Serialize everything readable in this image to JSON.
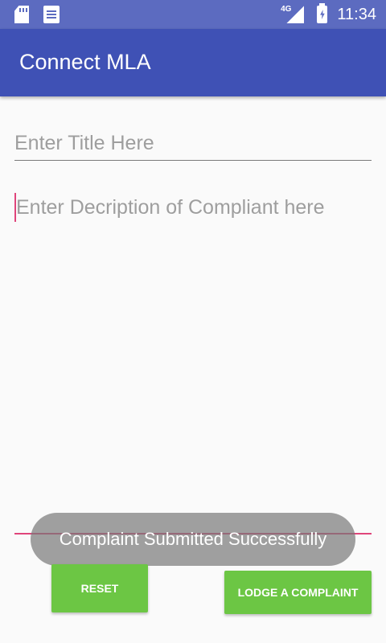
{
  "status_bar": {
    "left_icons": [
      "sd-card-icon",
      "notification-doc-icon"
    ],
    "network_label": "4G",
    "time": "11:34"
  },
  "app_bar": {
    "title": "Connect MLA"
  },
  "form": {
    "title_placeholder": "Enter Title Here",
    "title_value": "",
    "description_placeholder": "Enter Decription of Compliant here",
    "description_value": ""
  },
  "buttons": {
    "reset": "RESET",
    "lodge": "LODGE A COMPLAINT"
  },
  "toast": {
    "message": "Complaint Submitted Successfully"
  },
  "colors": {
    "status_bar": "#5c6bc0",
    "app_bar": "#3f51b5",
    "accent": "#e0457b",
    "button": "#6cc644"
  }
}
